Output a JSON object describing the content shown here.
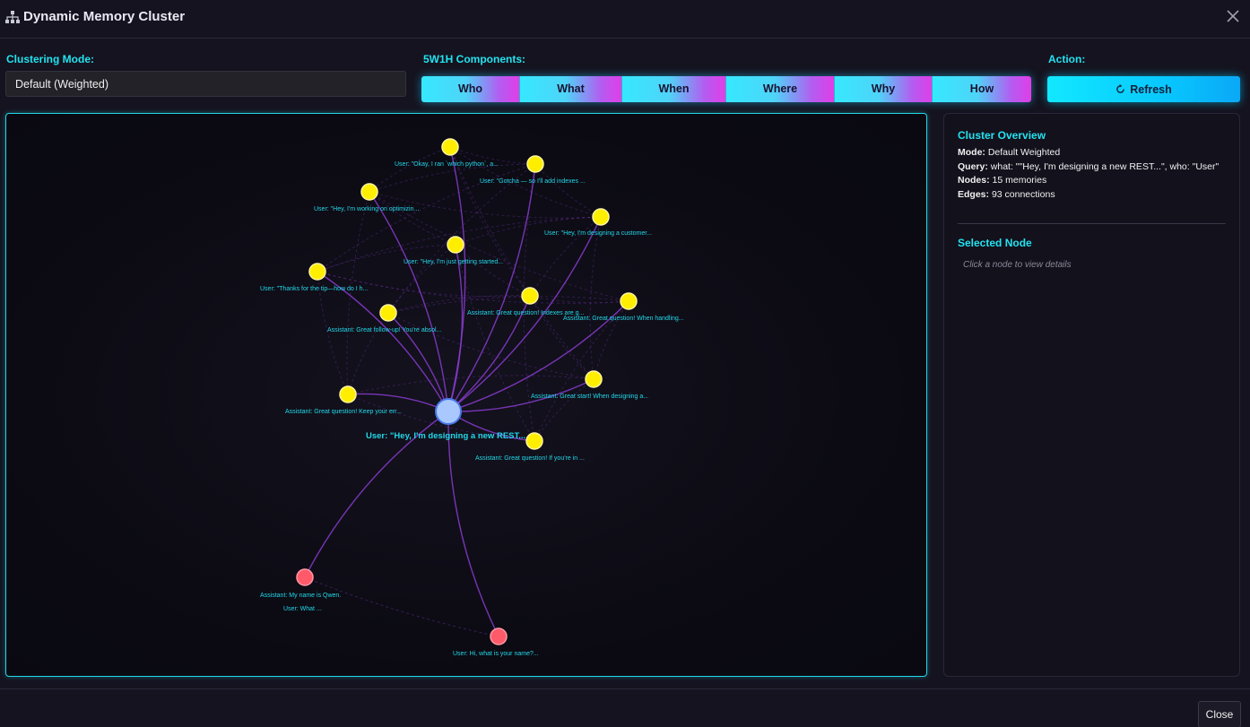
{
  "window": {
    "title": "Dynamic Memory Cluster",
    "title_icon": "sitemap-icon",
    "close_icon": "close-icon"
  },
  "controls": {
    "clustering_mode_label": "Clustering Mode:",
    "clustering_mode_value": "Default (Weighted)",
    "components_label": "5W1H Components:",
    "components": [
      "Who",
      "What",
      "When",
      "Where",
      "Why",
      "How"
    ],
    "action_label": "Action:",
    "refresh_label": "Refresh",
    "refresh_icon": "refresh-icon"
  },
  "graph": {
    "center_label": "User: \"Hey, I'm designing a new REST...",
    "nodes": [
      {
        "label": "User: \"Okay, I ran `which python`, a...",
        "kind": "related"
      },
      {
        "label": "User: \"Gotcha — so I'll add indexes ...",
        "kind": "related"
      },
      {
        "label": "User: \"Hey, I'm working on optimizin...",
        "kind": "related"
      },
      {
        "label": "User: \"Hey, I'm designing a customer...",
        "kind": "related"
      },
      {
        "label": "User: \"Hey, I'm just getting started...",
        "kind": "related"
      },
      {
        "label": "User: \"Thanks for the tip—how do I h...",
        "kind": "related"
      },
      {
        "label": "Assistant:  Great question! Indexes are g...",
        "kind": "related"
      },
      {
        "label": "Assistant:  Great question! When handling...",
        "kind": "related"
      },
      {
        "label": "Assistant:  Great follow-up! You're absol...",
        "kind": "related"
      },
      {
        "label": "Assistant:  Great start! When designing a...",
        "kind": "related"
      },
      {
        "label": "Assistant:  Great question! Keep your err...",
        "kind": "related"
      },
      {
        "label": "Assistant:  Great question! If you're in ...",
        "kind": "related"
      },
      {
        "label": "Assistant:  My name is Qwen.",
        "kind": "distant"
      },
      {
        "label": "User: What ...",
        "kind": "distant"
      },
      {
        "label": "User: Hi, what is your name?...",
        "kind": "distant"
      }
    ],
    "colors": {
      "center": "#a8c8ff",
      "related": "#ffee00",
      "distant": "#ff5a6a",
      "edge": "#8a3cd0",
      "label": "#21d8ea",
      "border": "#22d8e8"
    }
  },
  "overview": {
    "heading": "Cluster Overview",
    "mode_key": "Mode:",
    "mode_val": "Default Weighted",
    "query_key": "Query:",
    "query_val": "what: \"\"Hey, I'm designing a new REST...\", who: \"User\"",
    "nodes_key": "Nodes:",
    "nodes_val": "15 memories",
    "edges_key": "Edges:",
    "edges_val": "93 connections"
  },
  "selected": {
    "heading": "Selected Node",
    "hint": "Click a node to view details"
  },
  "footer": {
    "close_label": "Close"
  }
}
